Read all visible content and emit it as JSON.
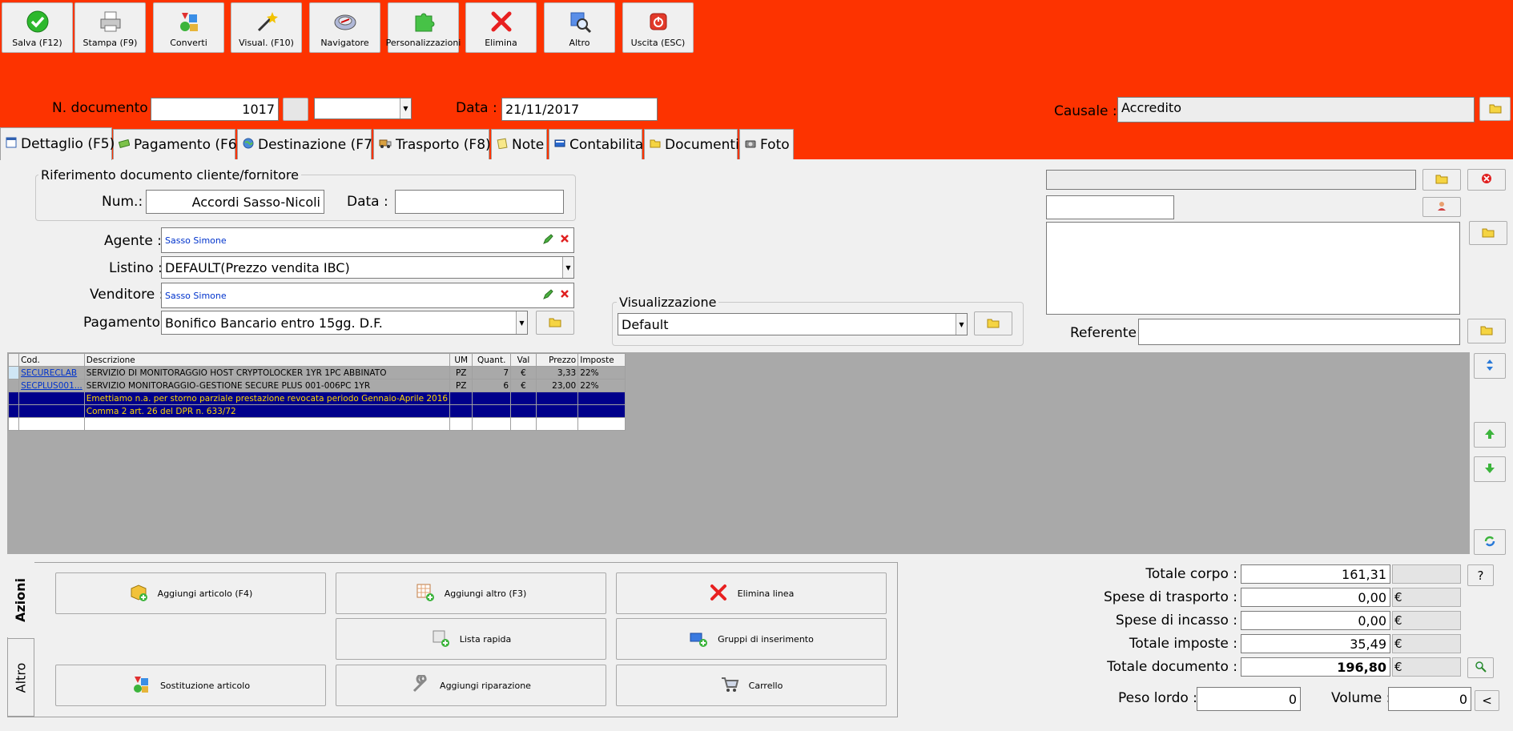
{
  "toolbar": {
    "save": "Salva (F12)",
    "print": "Stampa (F9)",
    "convert": "Converti",
    "view": "Visual. (F10)",
    "navigator": "Navigatore",
    "custom": "Personalizzazioni",
    "delete": "Elimina",
    "other": "Altro",
    "exit": "Uscita (ESC)"
  },
  "header": {
    "doc_label": "N. documento :",
    "doc_number": "1017",
    "date_label": "Data :",
    "date": "21/11/2017",
    "causale_label": "Causale :",
    "causale": "Accredito"
  },
  "tabs": [
    {
      "label": "Dettaglio (F5)"
    },
    {
      "label": "Pagamento (F6)"
    },
    {
      "label": "Destinazione (F7)"
    },
    {
      "label": "Trasporto (F8)"
    },
    {
      "label": "Note"
    },
    {
      "label": "Contabilita'"
    },
    {
      "label": "Documenti"
    },
    {
      "label": "Foto"
    }
  ],
  "detail": {
    "ref_group": "Riferimento documento cliente/fornitore",
    "num_label": "Num.:",
    "num_value": "Accordi Sasso-Nicoli",
    "data_label": "Data :",
    "data_value": "",
    "agent_label": "Agente :",
    "agent_value": "Sasso Simone",
    "list_label": "Listino :",
    "list_value": "DEFAULT(Prezzo vendita IBC)",
    "seller_label": "Venditore :",
    "seller_value": "Sasso Simone",
    "payment_label": "Pagamento :",
    "payment_value": "Bonifico Bancario entro 15gg. D.F.",
    "view_group": "Visualizzazione",
    "view_value": "Default",
    "referente_label": "Referente"
  },
  "grid": {
    "headers": [
      "Cod.",
      "Descrizione",
      "UM",
      "Quant.",
      "Val",
      "Prezzo",
      "Imposte"
    ],
    "rows": [
      {
        "code": "SECURECLAB",
        "desc": "SERVIZIO DI MONITORAGGIO HOST CRYPTOLOCKER 1YR 1PC ABBINATO",
        "um": "PZ",
        "qty": "7",
        "val": "€",
        "price": "3,33",
        "tax": "22%"
      },
      {
        "code": "SECPLUS001...",
        "desc": "SERVIZIO MONITORAGGIO-GESTIONE SECURE PLUS 001-006PC 1YR",
        "um": "PZ",
        "qty": "6",
        "val": "€",
        "price": "23,00",
        "tax": "22%"
      }
    ],
    "notes": [
      "Emettiamo n.a. per storno parziale prestazione revocata periodo Gennaio-Aprile 2016",
      "Comma 2 art. 26 del DPR n. 633/72"
    ]
  },
  "actions": {
    "side_tab_1": "Azioni",
    "side_tab_2": "Altro",
    "add_article": "Aggiungi articolo (F4)",
    "add_other": "Aggiungi altro (F3)",
    "delete_line": "Elimina linea",
    "quick_list": "Lista rapida",
    "insert_groups": "Gruppi di inserimento",
    "replace_article": "Sostituzione articolo",
    "add_repair": "Aggiungi riparazione",
    "cart": "Carrello"
  },
  "totals": {
    "body_label": "Totale corpo :",
    "body_value": "161,31",
    "transport_label": "Spese di trasporto :",
    "transport_value": "0,00",
    "collection_label": "Spese di incasso :",
    "collection_value": "0,00",
    "tax_label": "Totale imposte :",
    "tax_value": "35,49",
    "doc_label": "Totale documento :",
    "doc_value": "196,80",
    "currency": "€",
    "help": "?",
    "gross_label": "Peso lordo :",
    "gross_value": "0",
    "volume_label": "Volume :",
    "volume_value": "0",
    "less": "<"
  }
}
